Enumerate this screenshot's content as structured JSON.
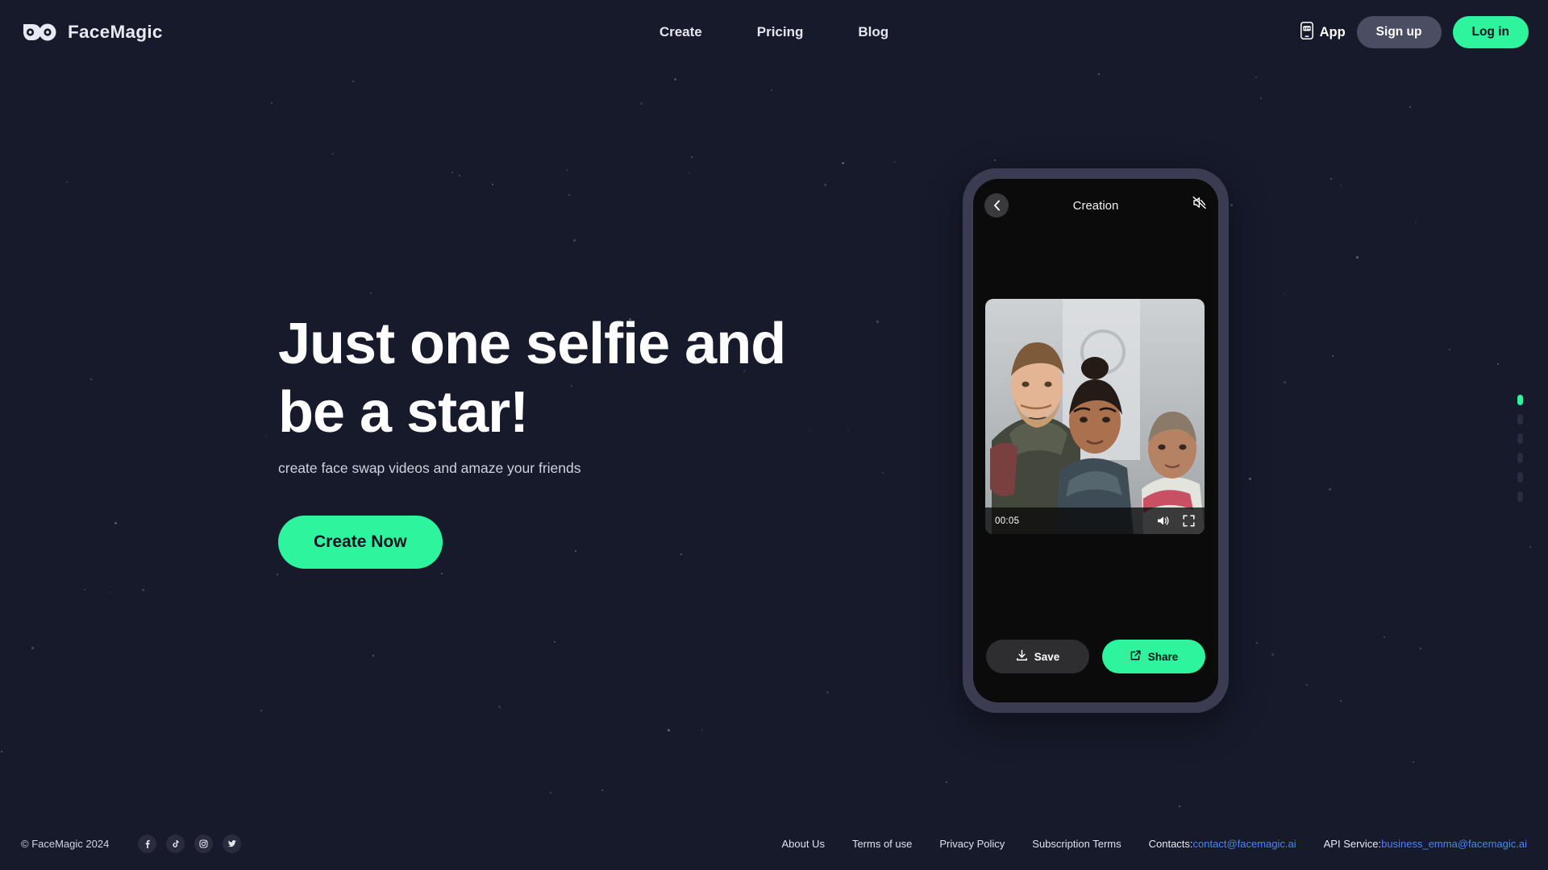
{
  "theme": {
    "background": "#171a2b",
    "accent_green": "#2ff49e",
    "link_blue": "#4c84f5",
    "phone_bezel": "#3b3c52"
  },
  "header": {
    "logo_text": "FaceMagic",
    "logo_icon": "facemagic-eyes-logo",
    "nav": [
      {
        "label": "Create"
      },
      {
        "label": "Pricing"
      },
      {
        "label": "Blog"
      }
    ],
    "app_label": "App",
    "app_icon": "mobile-app-icon",
    "signup_label": "Sign up",
    "login_label": "Log in"
  },
  "hero": {
    "title_line1": "Just one selfie and",
    "title_line2": "be a star!",
    "subtitle": "create face swap videos and amaze your friends",
    "cta_label": "Create Now"
  },
  "phone": {
    "title": "Creation",
    "back_icon": "chevron-left-icon",
    "mute_icon": "speaker-muted-icon",
    "video": {
      "time": "00:05",
      "volume_icon": "volume-icon",
      "fullscreen_icon": "fullscreen-icon"
    },
    "save_label": "Save",
    "save_icon": "download-icon",
    "share_label": "Share",
    "share_icon": "external-link-icon"
  },
  "page_dots": {
    "total": 6,
    "active_index": 0
  },
  "footer": {
    "copyright": "© FaceMagic 2024",
    "socials": [
      {
        "name": "facebook-icon",
        "glyph": "f"
      },
      {
        "name": "tiktok-icon",
        "glyph": "♪"
      },
      {
        "name": "instagram-icon",
        "glyph": "◉"
      },
      {
        "name": "twitter-icon",
        "glyph": "🐦"
      }
    ],
    "links": [
      {
        "label": "About Us"
      },
      {
        "label": "Terms of use"
      },
      {
        "label": "Privacy Policy"
      },
      {
        "label": "Subscription Terms"
      }
    ],
    "contacts_label": "Contacts:",
    "contacts_email": "contact@facemagic.ai",
    "api_label": "API Service:",
    "api_email": "business_emma@facemagic.ai"
  }
}
